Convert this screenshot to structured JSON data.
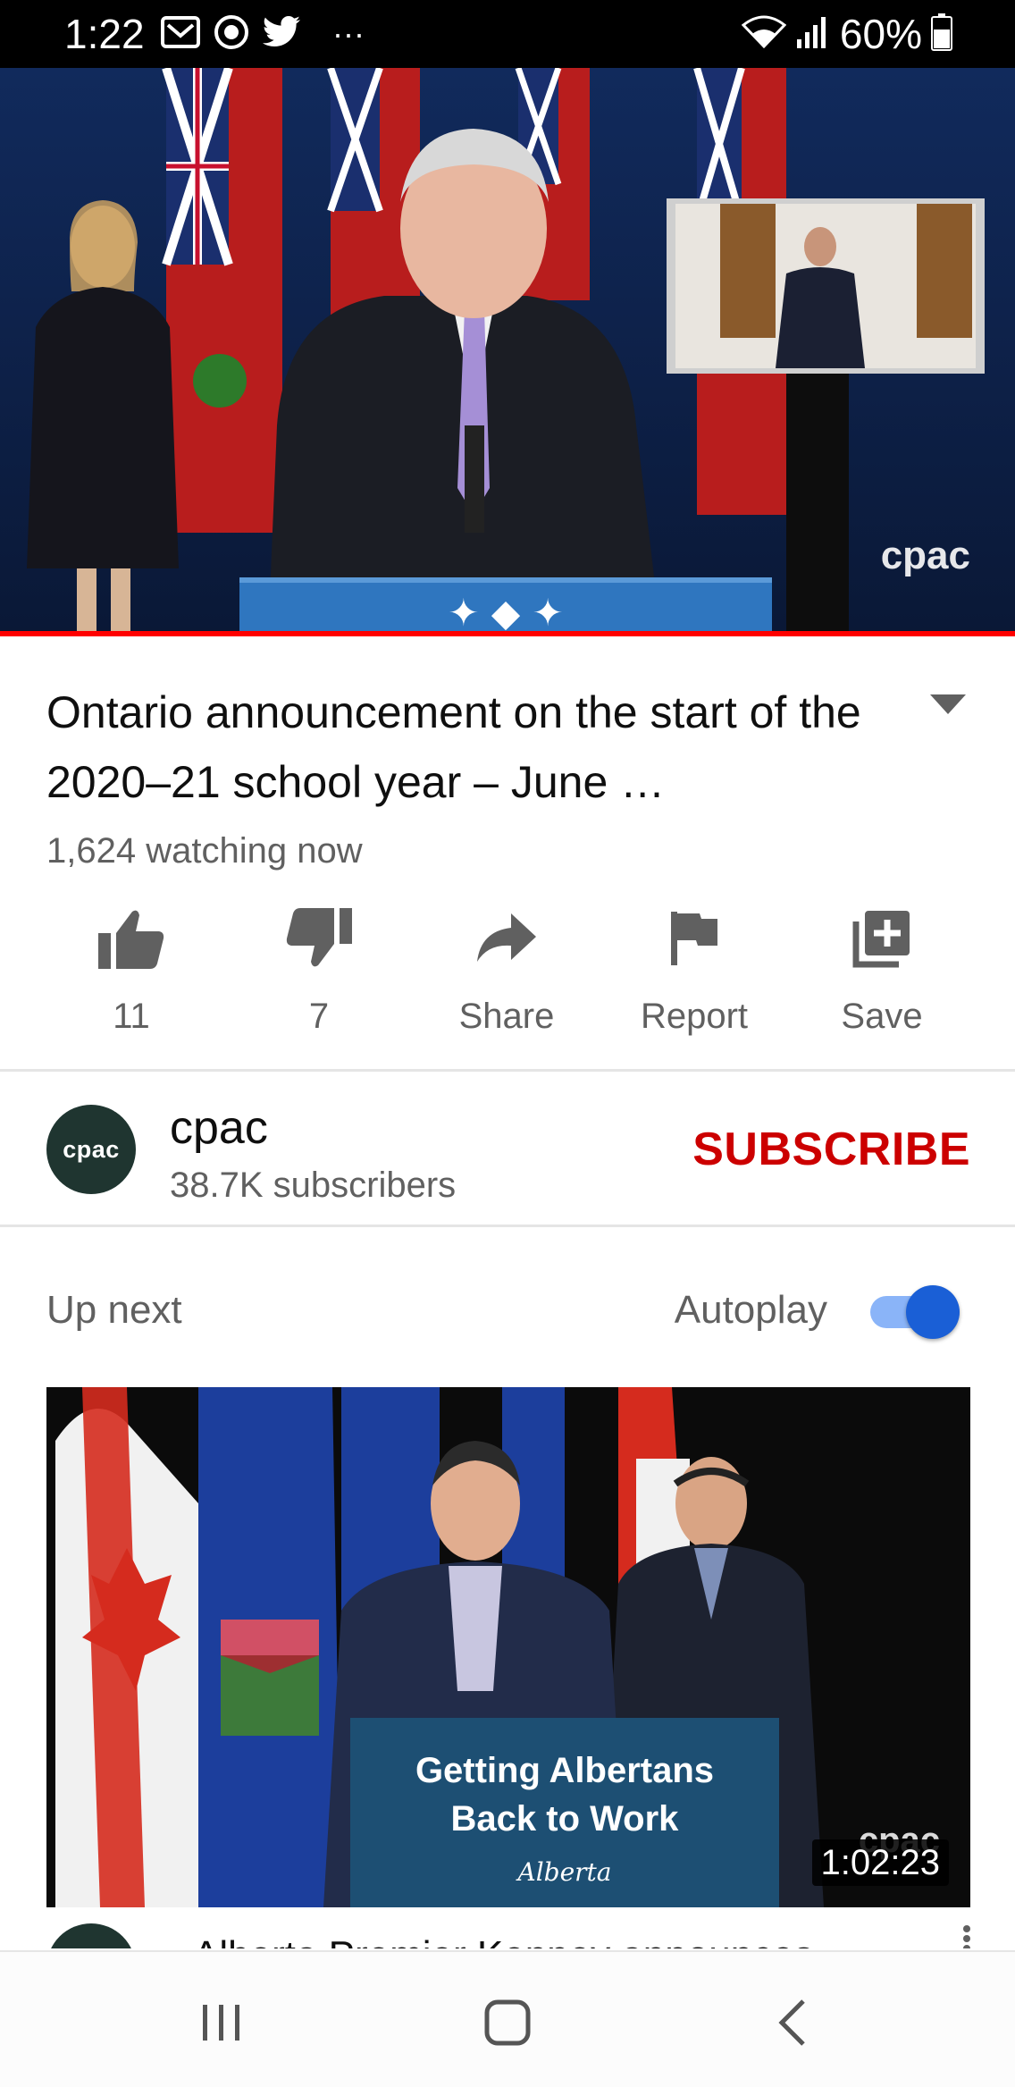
{
  "status_bar": {
    "time": "1:22",
    "left_icons": [
      "gmail-icon",
      "eye-icon",
      "twitter-icon",
      "more-icon"
    ],
    "more_glyph": "···",
    "right_icons": [
      "wifi-icon",
      "signal-icon",
      "battery-icon"
    ],
    "battery_percent": "60%"
  },
  "player": {
    "watermark": "cpac",
    "progress": 1.0,
    "progress_color": "#ff0000"
  },
  "video": {
    "title": "Ontario announcement on the start of the 2020–21 school year – June …",
    "watching": "1,624 watching now"
  },
  "actions": [
    {
      "icon": "thumbs-up-icon",
      "label": "11"
    },
    {
      "icon": "thumbs-down-icon",
      "label": "7"
    },
    {
      "icon": "share-icon",
      "label": "Share"
    },
    {
      "icon": "flag-icon",
      "label": "Report"
    },
    {
      "icon": "playlist-add-icon",
      "label": "Save"
    }
  ],
  "channel": {
    "avatar_text": "cpac",
    "name": "cpac",
    "subscribers": "38.7K subscribers",
    "subscribe_label": "SUBSCRIBE",
    "subscribe_color": "#cc0000"
  },
  "up_next": {
    "heading": "Up next",
    "autoplay_label": "Autoplay",
    "autoplay_on": true,
    "thumbnail": {
      "podium_line1": "Getting Albertans",
      "podium_line2": "Back to Work",
      "podium_logo": "Alberta",
      "watermark": "cpac",
      "duration": "1:02:23"
    },
    "next_title_partial": "Alberta Premier Kenney announces"
  },
  "nav_bar": {
    "buttons": [
      "recent-apps-icon",
      "home-icon",
      "back-icon"
    ]
  }
}
